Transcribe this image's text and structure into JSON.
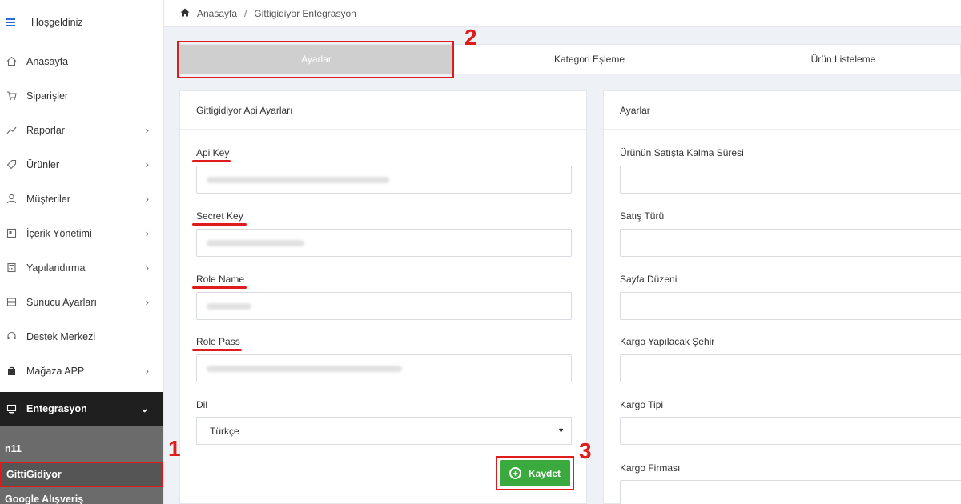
{
  "sidebar": {
    "brand": "Hoşgeldiniz",
    "items": [
      {
        "label": "Anasayfa",
        "icon": "home-icon"
      },
      {
        "label": "Siparişler",
        "icon": "cart-icon"
      },
      {
        "label": "Raporlar",
        "icon": "chart-icon"
      },
      {
        "label": "Ürünler",
        "icon": "tag-icon"
      },
      {
        "label": "Müşteriler",
        "icon": "user-icon"
      },
      {
        "label": "İçerik Yönetimi",
        "icon": "content-icon"
      },
      {
        "label": "Yapılandırma",
        "icon": "calculator-icon"
      },
      {
        "label": "Sunucu Ayarları",
        "icon": "server-icon"
      },
      {
        "label": "Destek Merkezi",
        "icon": "headset-icon"
      },
      {
        "label": "Mağaza APP",
        "icon": "bag-icon"
      },
      {
        "label": "Entegrasyon",
        "icon": "integration-icon"
      }
    ],
    "sub_items": [
      "n11",
      "GittiGidiyor",
      "Google Alışveriş"
    ]
  },
  "breadcrumb": {
    "home": "Anasayfa",
    "separator": "/",
    "current": "Gittigidiyor Entegrasyon"
  },
  "tabs": [
    "Ayarlar",
    "Kategori Eşleme",
    "Ürün Listeleme"
  ],
  "left_panel": {
    "title": "Gittigidiyor Api Ayarları",
    "fields": [
      {
        "label": "Api Key"
      },
      {
        "label": "Secret Key"
      },
      {
        "label": "Role Name"
      },
      {
        "label": "Role Pass"
      }
    ],
    "language_label": "Dil",
    "language_value": "Türkçe",
    "save_label": "Kaydet"
  },
  "right_panel": {
    "title": "Ayarlar",
    "fields": [
      {
        "label": "Ürünün Satışta Kalma Süresi"
      },
      {
        "label": "Satış Türü"
      },
      {
        "label": "Sayfa Düzeni"
      },
      {
        "label": "Kargo Yapılacak Şehir"
      },
      {
        "label": "Kargo Tipi"
      },
      {
        "label": "Kargo Firması"
      }
    ]
  },
  "annotations": [
    "1",
    "2",
    "3"
  ],
  "colors": {
    "accent": "#e01b1b",
    "save": "#3aaa3e",
    "active_nav": "#1f1f1f",
    "submenu": "#6b6b6b"
  }
}
